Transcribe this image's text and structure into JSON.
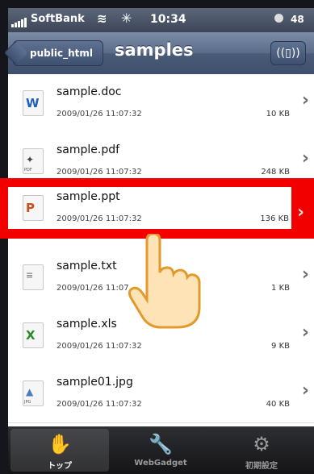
{
  "status": {
    "carrier": "SoftBank",
    "time": "10:34",
    "battery": "48"
  },
  "nav": {
    "back_label": "public_html",
    "title": "samples"
  },
  "files": [
    {
      "name": "sample.doc",
      "date": "2009/01/26 11:07:32",
      "size": "10 KB",
      "icon": "word-doc-icon"
    },
    {
      "name": "sample.pdf",
      "date": "2009/01/26 11:07:32",
      "size": "248 KB",
      "icon": "pdf-icon"
    },
    {
      "name": "sample.ppt",
      "date": "2009/01/26 11:07:32",
      "size": "136 KB",
      "icon": "powerpoint-icon"
    },
    {
      "name": "sample.txt",
      "date": "2009/01/26 11:07",
      "size": "1 KB",
      "icon": "text-file-icon"
    },
    {
      "name": "sample.xls",
      "date": "2009/01/26 11:07:32",
      "size": "9 KB",
      "icon": "excel-icon"
    },
    {
      "name": "sample01.jpg",
      "date": "2009/01/26 11:07:32",
      "size": "40 KB",
      "icon": "jpg-image-icon"
    }
  ],
  "tabs": [
    {
      "label": "トップ",
      "icon": "top-icon",
      "active": true
    },
    {
      "label": "WebGadget",
      "icon": "wrench-icon",
      "active": false
    },
    {
      "label": "初期設定",
      "icon": "gear-icon",
      "active": false
    }
  ],
  "colors": {
    "highlight": "#f20000",
    "nav": "#4a5b78"
  }
}
